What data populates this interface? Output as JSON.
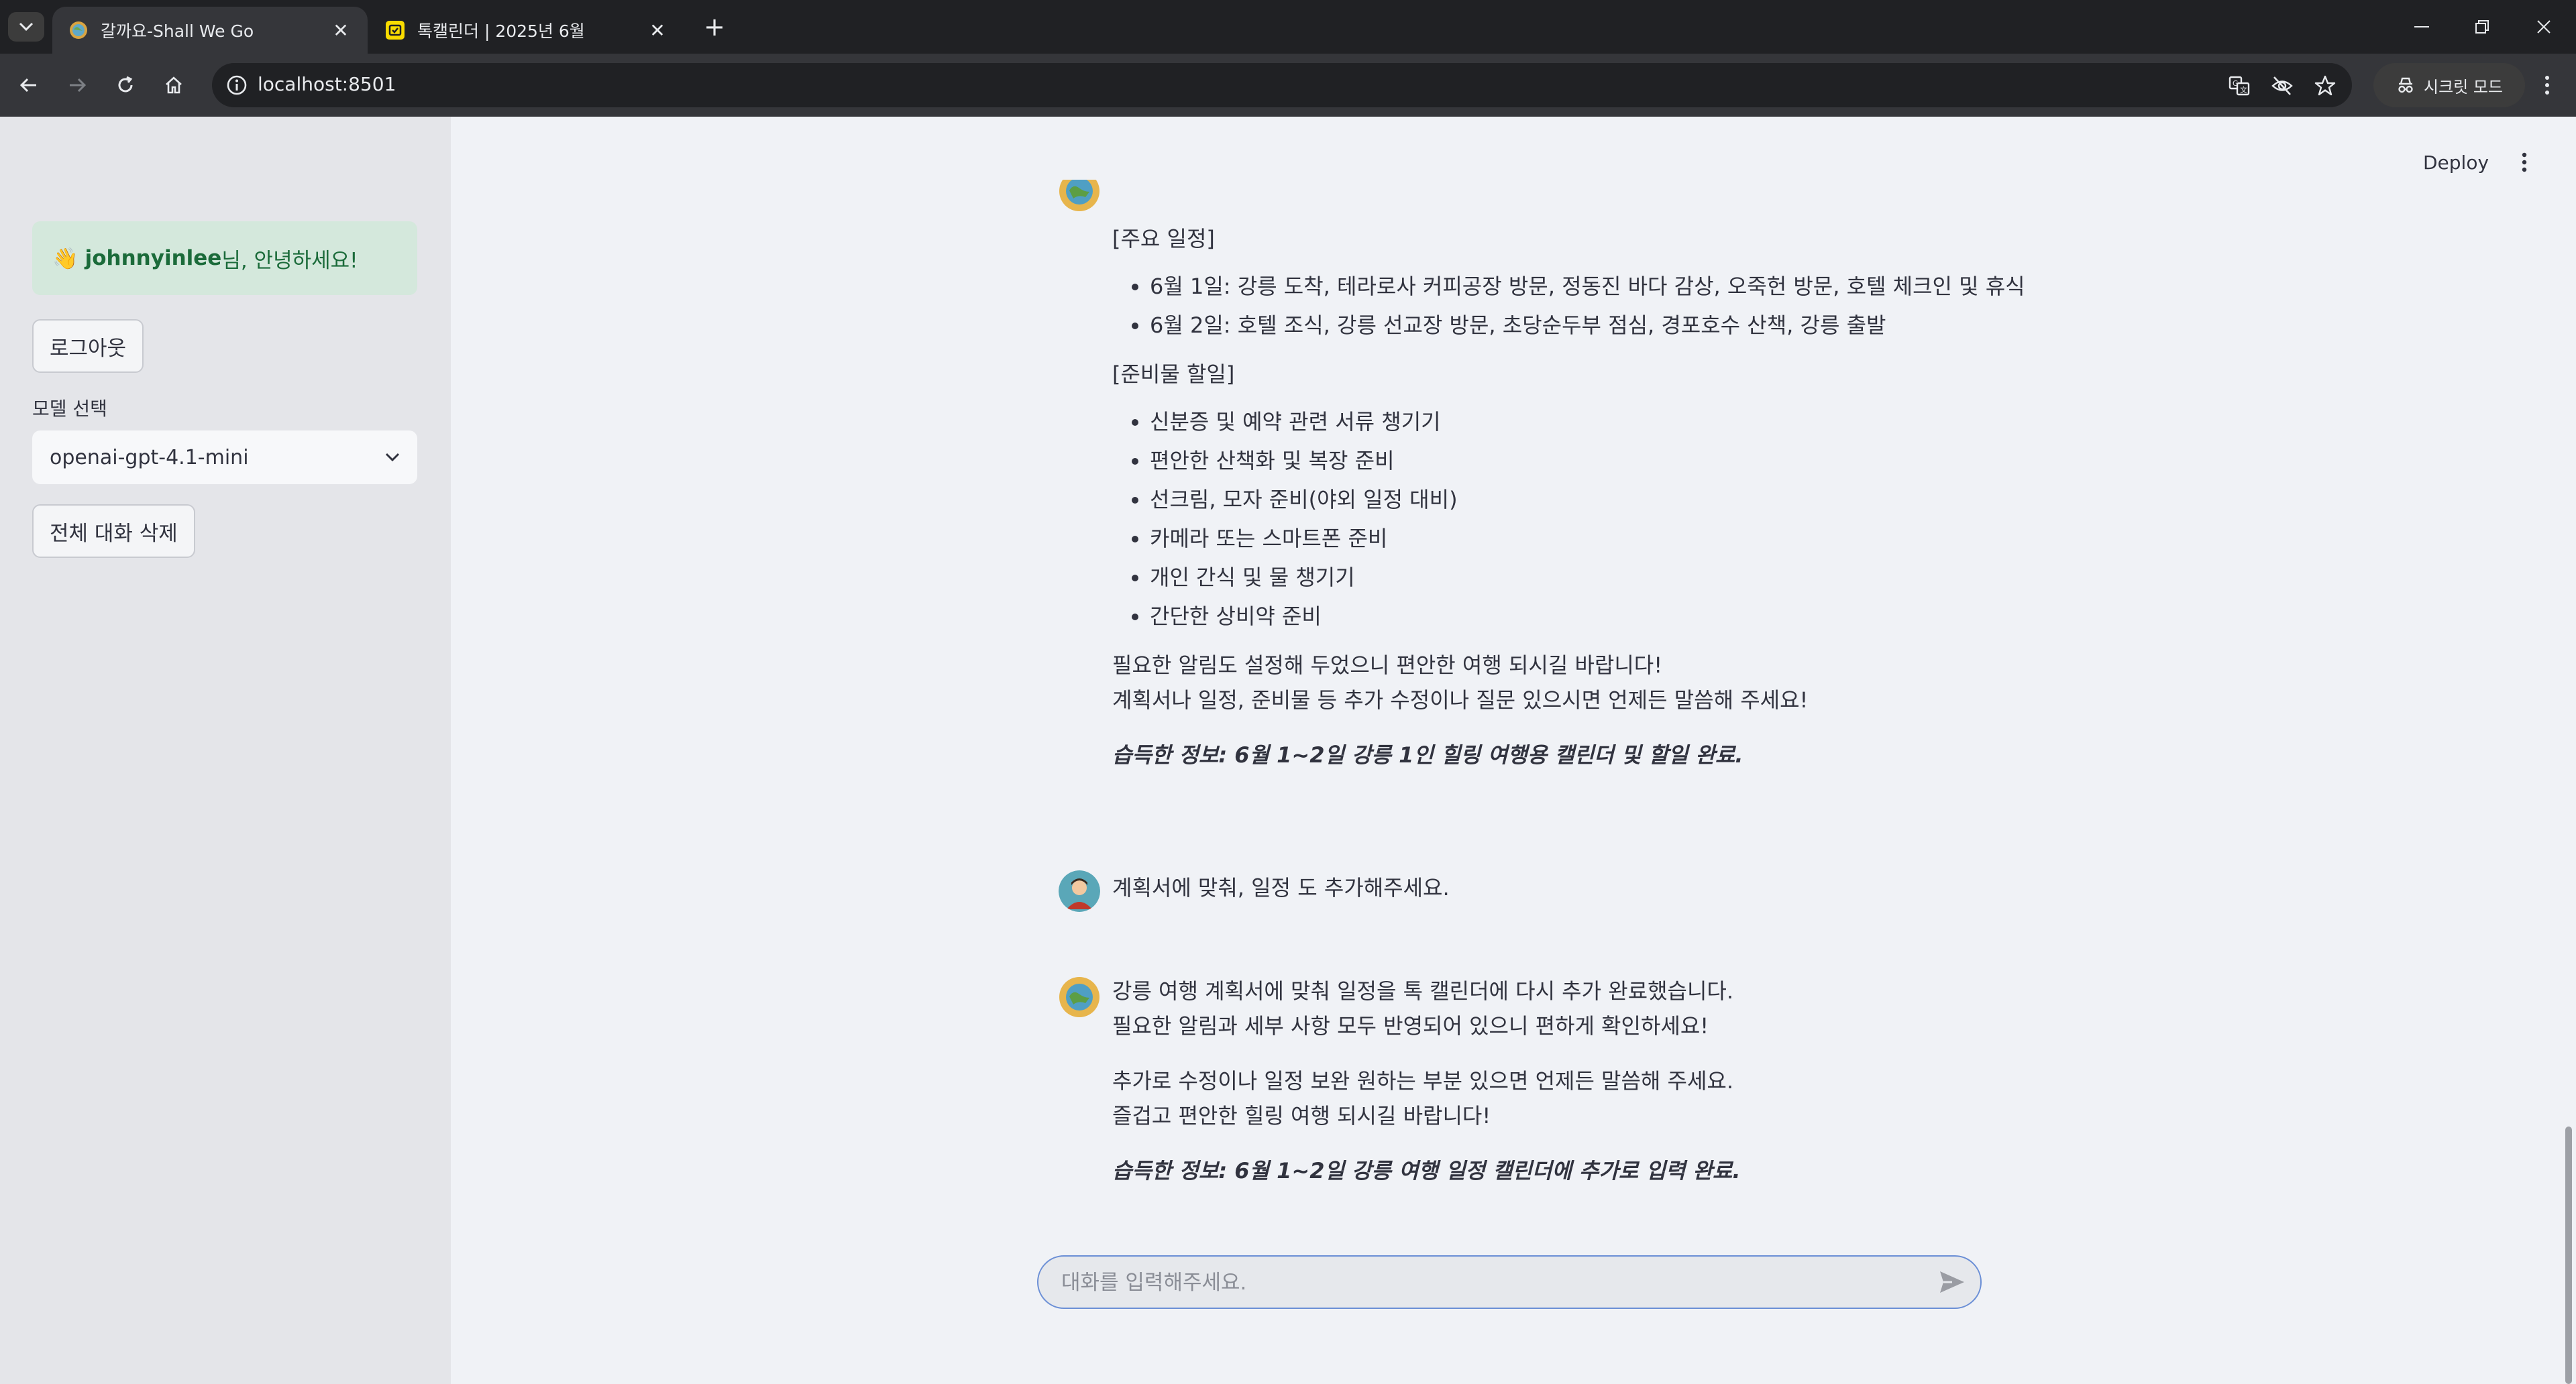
{
  "browser": {
    "tabs": [
      {
        "title": "갈까요-Shall We Go",
        "active": true
      },
      {
        "title": "톡캘린더 | 2025년 6월",
        "active": false
      }
    ],
    "url": "localhost:8501",
    "incognito_label": "시크릿 모드"
  },
  "sidebar": {
    "greeting_emoji": "👋",
    "greeting_user": "johnnyinlee",
    "greeting_suffix": "님, 안녕하세요!",
    "logout_label": "로그아웃",
    "model_label": "모델 선택",
    "model_value": "openai-gpt-4.1-mini",
    "clear_label": "전체 대화 삭제"
  },
  "header": {
    "deploy_label": "Deploy"
  },
  "chat": {
    "msg1": {
      "section1_title": "[주요 일정]",
      "schedule": [
        "6월 1일: 강릉 도착, 테라로사 커피공장 방문, 정동진 바다 감상, 오죽헌 방문, 호텔 체크인 및 휴식",
        "6월 2일: 호텔 조식, 강릉 선교장 방문, 초당순두부 점심, 경포호수 산책, 강릉 출발"
      ],
      "section2_title": "[준비물 할일]",
      "todos": [
        "신분증 및 예약 관련 서류 챙기기",
        "편안한 산책화 및 복장 준비",
        "선크림, 모자 준비(야외 일정 대비)",
        "카메라 또는 스마트폰 준비",
        "개인 간식 및 물 챙기기",
        "간단한 상비약 준비"
      ],
      "closing_1": "필요한 알림도 설정해 두었으니 편안한 여행 되시길 바랍니다!",
      "closing_2": "계획서나 일정, 준비물 등 추가 수정이나 질문 있으시면 언제든 말씀해 주세요!",
      "info": "습득한 정보: 6월 1~2일 강릉 1인 힐링 여행용 캘린더 및 할일 완료."
    },
    "user_msg": "계획서에 맞춰, 일정 도 추가해주세요.",
    "msg2": {
      "line1": "강릉 여행 계획서에 맞춰 일정을 톡 캘린더에 다시 추가 완료했습니다.",
      "line2": "필요한 알림과 세부 사항 모두 반영되어 있으니 편하게 확인하세요!",
      "line3": "추가로 수정이나 일정 보완 원하는 부분 있으면 언제든 말씀해 주세요.",
      "line4": "즐겁고 편안한 힐링 여행 되시길 바랍니다!",
      "info": "습득한 정보: 6월 1~2일 강릉 여행 일정 캘린더에 추가로 입력 완료."
    },
    "input_placeholder": "대화를 입력해주세요."
  },
  "colors": {
    "accent": "#6b8fd6",
    "greeting_bg": "#d4e8dc",
    "greeting_text": "#1b6b3a"
  }
}
